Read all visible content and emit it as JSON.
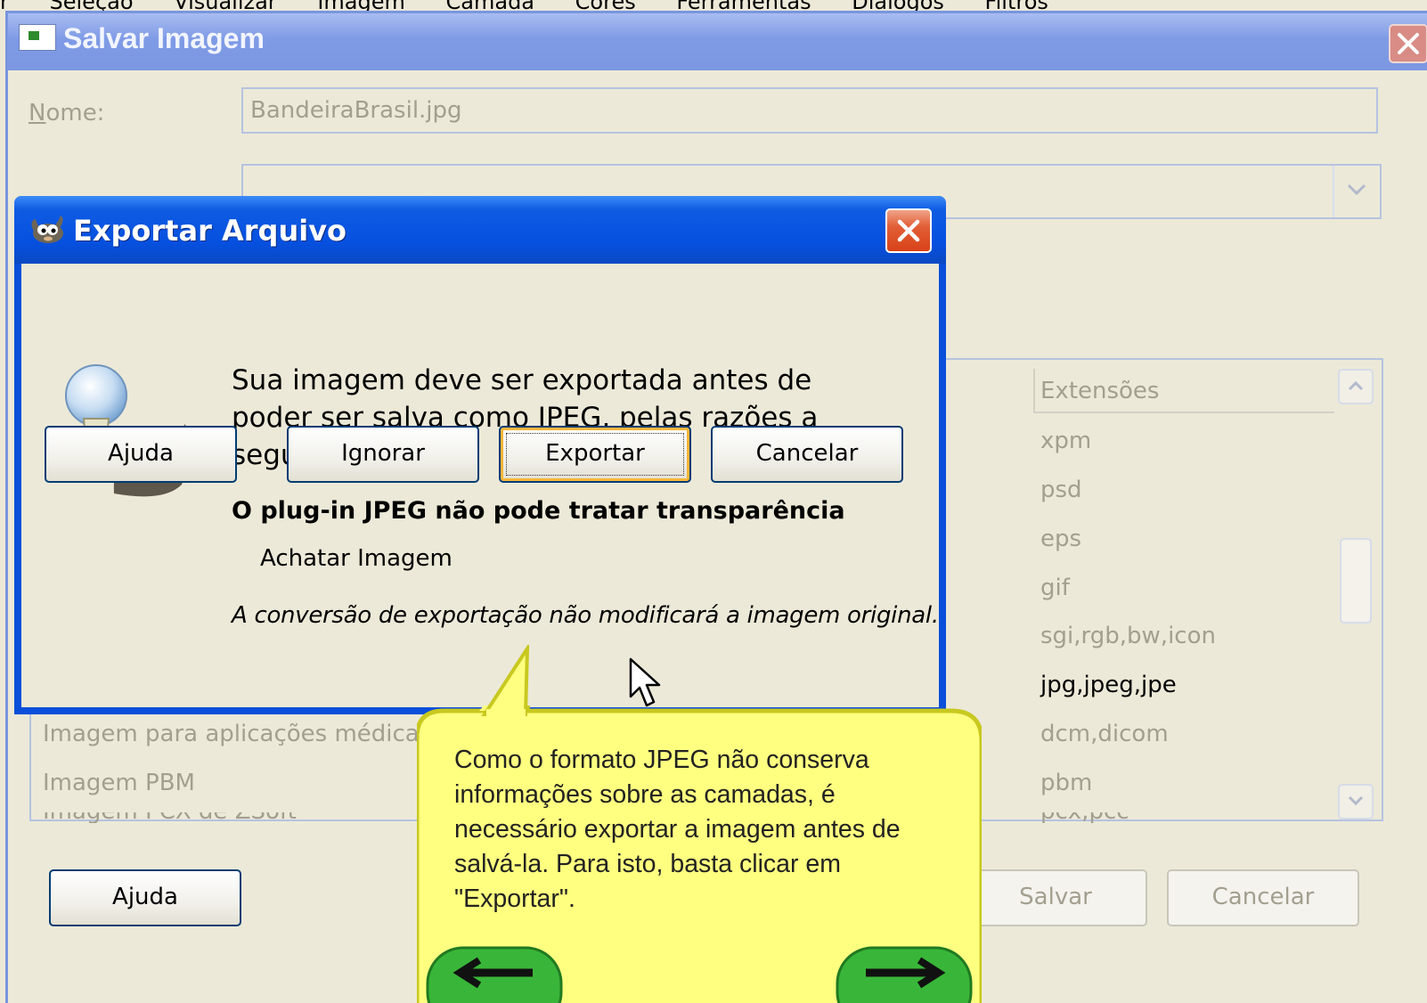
{
  "menubar": {
    "items": [
      "r",
      "Seleção",
      "Visualizar",
      "Imagem",
      "Camada",
      "Cores",
      "Ferramentas",
      "Diálogos",
      "Filtros"
    ]
  },
  "save_dialog": {
    "title": "Salvar Imagem",
    "name_label_prefix": "N",
    "name_label_rest": "ome:",
    "name_value": "BandeiraBrasil.jpg",
    "extensions_header": "Extensões",
    "extensions": [
      "xpm",
      "psd",
      "eps",
      "gif",
      "sgi,rgb,bw,icon",
      "jpg,jpeg,jpe",
      "dcm,dicom",
      "pbm",
      "pcx,pcc"
    ],
    "selected_extension_index": 5,
    "file_types": [
      "Imagem para aplicações médicas",
      "Imagem PBM",
      "Imagem PCX de ZSoft"
    ],
    "buttons": {
      "help": "Ajuda",
      "save": "Salvar",
      "cancel": "Cancelar"
    }
  },
  "export_dialog": {
    "title": "Exportar Arquivo",
    "message_line1": "Sua imagem deve ser exportada antes de",
    "message_line2": "poder ser salva como JPEG, pelas razões a",
    "message_line3": "seguir:",
    "reason": "O plug-in JPEG não pode tratar transparência",
    "action": "Achatar Imagem",
    "note": "A conversão de exportação não modificará a imagem original.",
    "buttons": {
      "help": "Ajuda",
      "ignore": "Ignorar",
      "export": "Exportar",
      "cancel": "Cancelar"
    }
  },
  "callout": {
    "text": "Como o formato JPEG não conserva informações sobre as camadas, é necessário exportar a imagem antes de salvá-la. Para isto, basta clicar em \"Exportar\"."
  },
  "colors": {
    "xp_title_blue": "#0650df",
    "dialog_bg": "#ece9d8",
    "callout_yellow": "#ffff80",
    "callout_border": "#c8c820",
    "nav_green": "#2fb12f"
  },
  "icons": [
    "close-icon",
    "chevron-down-icon",
    "gimp-icon",
    "lightbulb-wilber-icon",
    "arrow-left-icon",
    "arrow-right-icon",
    "mouse-cursor-icon"
  ]
}
